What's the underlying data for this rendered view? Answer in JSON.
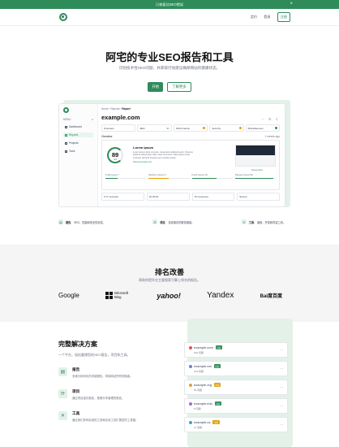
{
  "announcement": {
    "text": "已修复比SEO错误",
    "close": "×"
  },
  "nav": {
    "links": [
      "定价",
      "登录"
    ],
    "signup": "注册"
  },
  "hero": {
    "title": "阿宅的专业SEO报告和工具",
    "subtitle": "识别技术性SEO问题，并获取行动建议确保网站的健康状态。",
    "primary": "开始",
    "secondary": "了解更多"
  },
  "preview": {
    "menu_label": "MENU",
    "menu_toggle": "≡",
    "sidebar": [
      "Dashboard",
      "Reports",
      "Projects",
      "Tools"
    ],
    "breadcrumb": [
      "Home",
      "Reports",
      "Report"
    ],
    "domain": "example.com",
    "tools": [
      "⋯",
      "↻",
      "⇩"
    ],
    "tabs": [
      {
        "label": "Overview",
        "value": "",
        "color": ""
      },
      {
        "label": "SEO",
        "value": "91",
        "color": "#2f8b5a"
      },
      {
        "label": "Performance",
        "value": "",
        "color": "#e3a008"
      },
      {
        "label": "Security",
        "value": "",
        "color": "#e3a008"
      },
      {
        "label": "Miscellaneous",
        "value": "",
        "color": "#2f8b5a"
      }
    ],
    "overview_title": "Overview",
    "overview_time": "1 minute ago",
    "score": "89",
    "score_of": "100",
    "lorem_title": "Lorem Ipsum",
    "lorem_desc": "Lorem ipsum dolor sit amet, consectetur adipiscing elit. Vivamus eleifend ullamcorper diam vitae commodo. Class aptent taciti sociosqu ad litora torquent per conubia nostra.",
    "lorem_url": "https://example.com",
    "screenshot_label": "Screenshot",
    "metrics": [
      {
        "label": "Total issues",
        "value": "7",
        "color": "#2f8b5a",
        "fraction": 0.3
      },
      {
        "label": "Medium issues",
        "value": "5",
        "color": "#e3a008",
        "fraction": 0.5
      },
      {
        "label": "Fixed issues",
        "value": "16",
        "color": "#2f8b5a",
        "fraction": 0.6
      },
      {
        "label": "Passed issues",
        "value": "96",
        "color": "#2f8b5a",
        "fraction": 0.95
      }
    ],
    "stats": [
      "0.77 seconds",
      "32.35 kb",
      "75 resources",
      "Secure"
    ]
  },
  "features": [
    {
      "icon": "▤",
      "bold": "报告.",
      "text": "SEO，性能和安全性测试。"
    },
    {
      "icon": "⟳",
      "bold": "项目.",
      "text": "自动保存的报告链接。"
    },
    {
      "icon": "✕",
      "bold": "工具.",
      "text": "被用，开发和内容工具。"
    }
  ],
  "ranking": {
    "title": "排名改善",
    "subtitle": "帮助你提升在主要搜索引擎上排名的报告。",
    "engines": [
      "Google",
      "Microsoft Bing",
      "yahoo!",
      "Yandex",
      "Bai度百度"
    ]
  },
  "solutions": {
    "title": "完整解决方案",
    "subtitle": "一个平台，轻松重建您的SEO报告，项目和工具。",
    "items": [
      {
        "icon": "▤",
        "title": "报告",
        "desc": "多维分析网页的详细报告，排除网站所有的隐患。"
      },
      {
        "icon": "⟳",
        "title": "项目",
        "desc": "通过项目保存报告，更便分享管理的报告。"
      },
      {
        "icon": "✕",
        "title": "工具",
        "desc": "通过我们多种实用的工具和实用工具扩展您的工具箱。"
      }
    ]
  },
  "sites": [
    {
      "domain": "example.com",
      "badge": "良好",
      "badge_color": "#2f8b5a",
      "dot": "#e05353",
      "desc": "100 问题"
    },
    {
      "domain": "example.net",
      "badge": "良好",
      "badge_color": "#2f8b5a",
      "dot": "#6b7ee0",
      "desc": "123 问题"
    },
    {
      "domain": "example.org",
      "badge": "中等",
      "badge_color": "#e3a008",
      "dot": "#e0a040",
      "desc": "50 问题"
    },
    {
      "domain": "example.edu",
      "badge": "良好",
      "badge_color": "#2f8b5a",
      "dot": "#9f6ad8",
      "desc": "5 问题"
    },
    {
      "domain": "example.us",
      "badge": "中等",
      "badge_color": "#e3a008",
      "dot": "#3aa0d8",
      "desc": "11 问题"
    }
  ]
}
